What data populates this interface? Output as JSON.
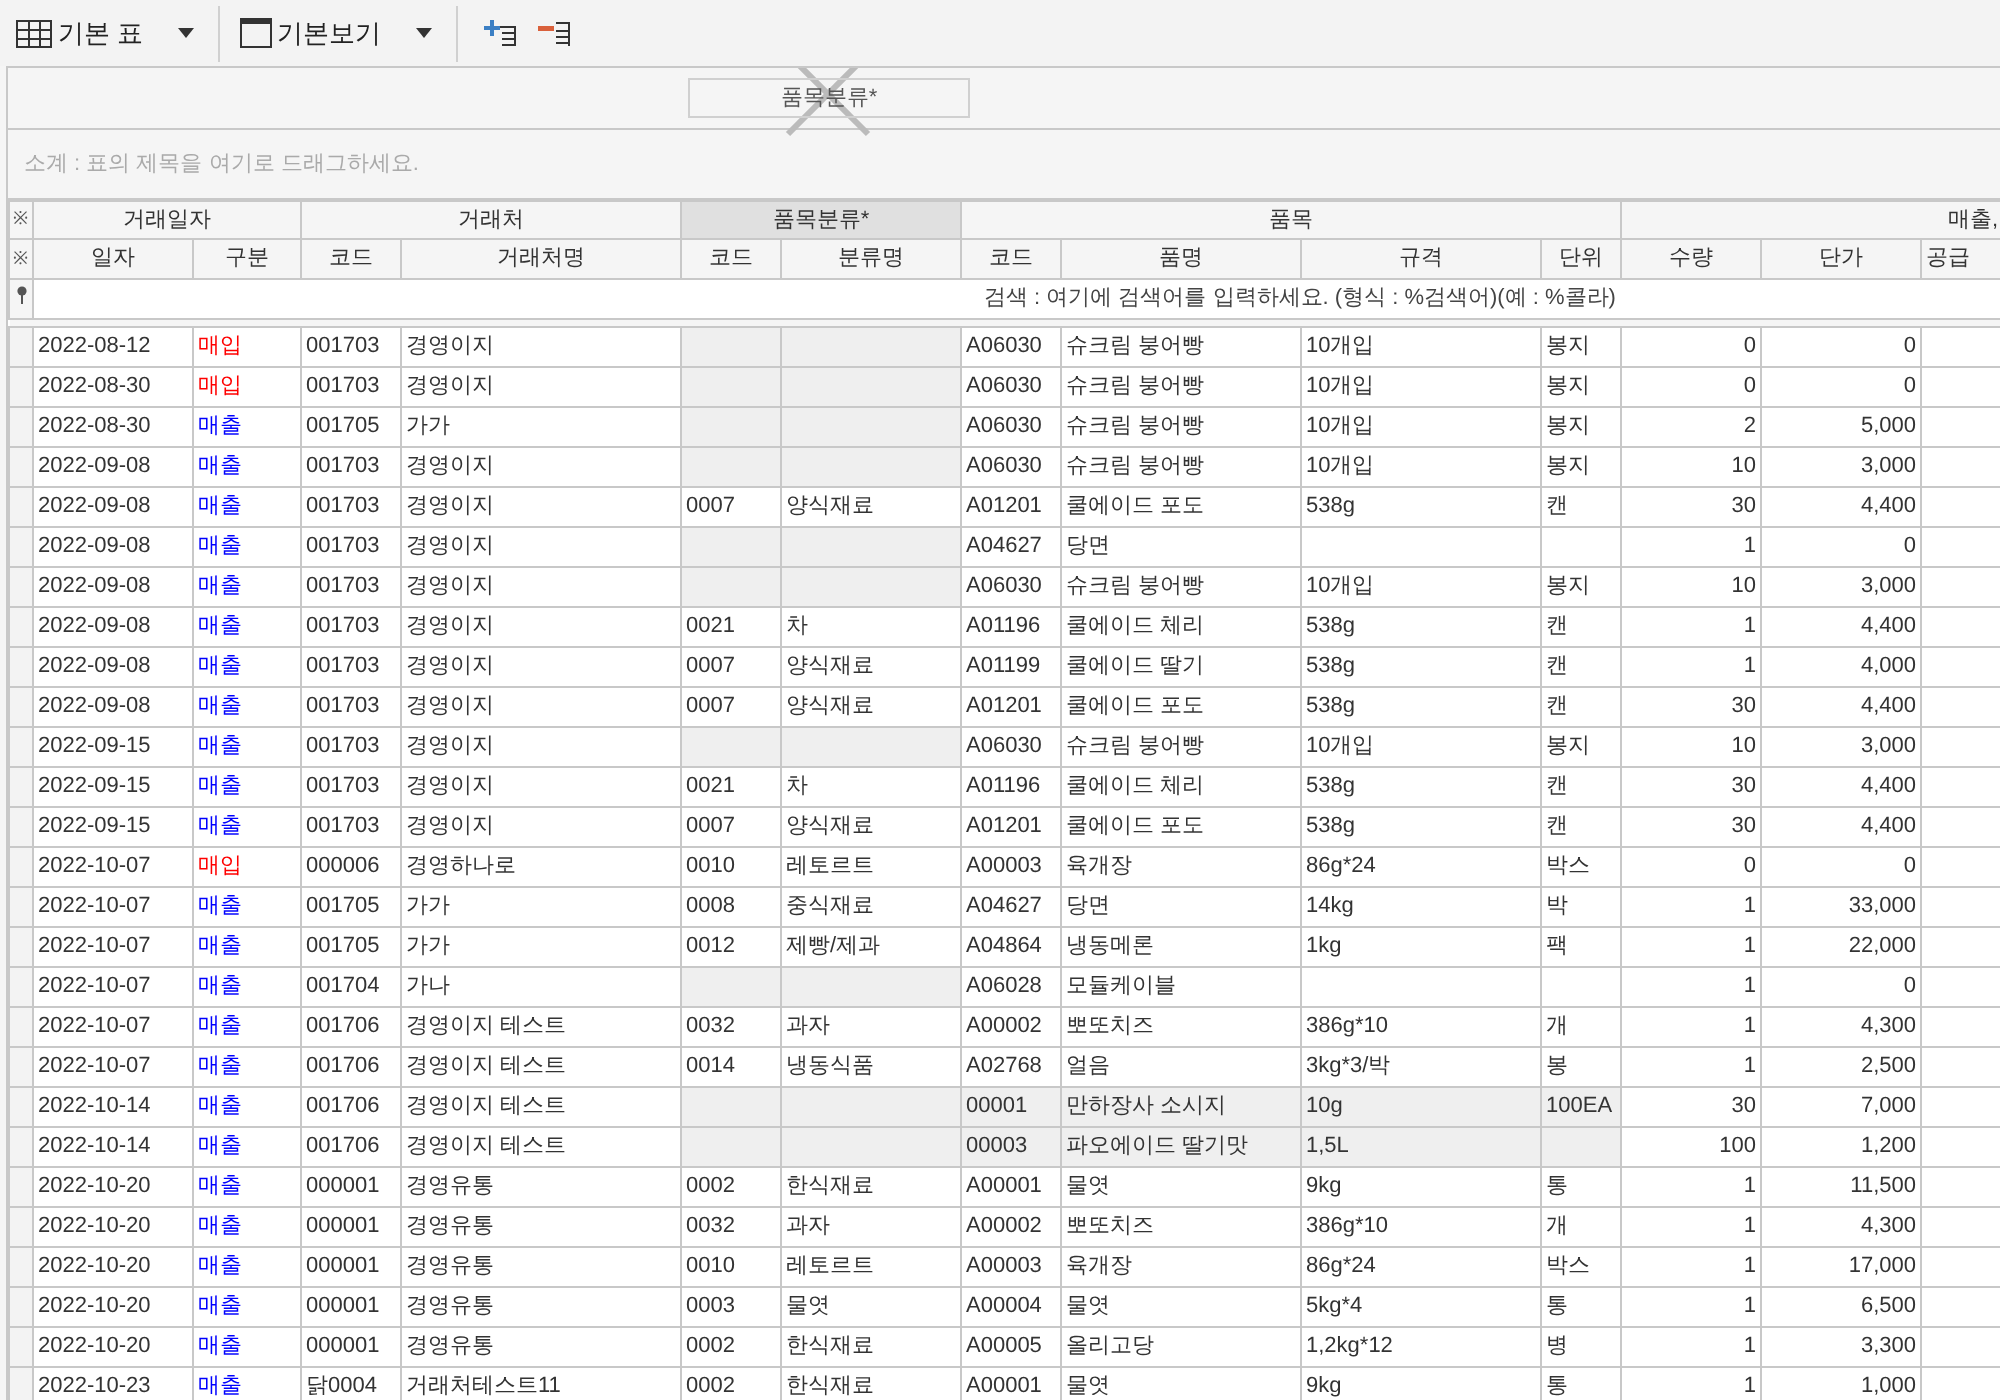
{
  "toolbar": {
    "items": [
      {
        "kind": "table-view",
        "label": "기본 표"
      },
      {
        "kind": "window-view",
        "label": "기본보기"
      },
      {
        "kind": "add-row"
      },
      {
        "kind": "remove-row"
      }
    ]
  },
  "group_panel": {
    "chips": [
      "품목분류*"
    ],
    "drop_blocked": true
  },
  "subtotal_hint": "소계 : 표의 제목을 여기로 드래그하세요.",
  "table": {
    "header_marks": [
      "※",
      "※"
    ],
    "column_groups": [
      {
        "label": "거래일자",
        "selected": false,
        "columns": [
          "일자",
          "구분"
        ]
      },
      {
        "label": "거래처",
        "selected": false,
        "columns": [
          "코드",
          "거래처명"
        ]
      },
      {
        "label": "품목분류*",
        "selected": true,
        "columns": [
          "코드",
          "분류명"
        ]
      },
      {
        "label": "품목",
        "selected": false,
        "columns": [
          "코드",
          "품명",
          "규격",
          "단위"
        ]
      },
      {
        "label": "매출,",
        "selected": false,
        "columns": [
          "수량",
          "단가",
          "공급"
        ]
      }
    ],
    "search_hint": "검색 : 여기에 검색어를 입력하세요. (형식 : %검색어)(예 : %콜라)",
    "rows": [
      {
        "date": "2022-08-12",
        "type": "매입",
        "color": "#ff0000",
        "vendor_code": "001703",
        "vendor_name": "경영이지",
        "item_code": "A06030",
        "item_name": "슈크림 붕어빵",
        "spec": "10개입",
        "unit": "봉지",
        "qty": "0",
        "price": "0",
        "product_shaded": false
      },
      {
        "date": "2022-08-30",
        "type": "매입",
        "color": "#ff0000",
        "vendor_code": "001703",
        "vendor_name": "경영이지",
        "item_code": "A06030",
        "item_name": "슈크림 붕어빵",
        "spec": "10개입",
        "unit": "봉지",
        "qty": "0",
        "price": "0",
        "product_shaded": false
      },
      {
        "date": "2022-08-30",
        "type": "매출",
        "color": "#0000ff",
        "vendor_code": "001705",
        "vendor_name": "가가",
        "item_code": "A06030",
        "item_name": "슈크림 붕어빵",
        "spec": "10개입",
        "unit": "봉지",
        "qty": "2",
        "price": "5,000",
        "product_shaded": false
      },
      {
        "date": "2022-09-08",
        "type": "매출",
        "color": "#0000ff",
        "vendor_code": "001703",
        "vendor_name": "경영이지",
        "item_code": "A06030",
        "item_name": "슈크림 붕어빵",
        "spec": "10개입",
        "unit": "봉지",
        "qty": "10",
        "price": "3,000",
        "product_shaded": false
      },
      {
        "date": "2022-09-08",
        "type": "매출",
        "color": "#0000ff",
        "vendor_code": "001703",
        "vendor_name": "경영이지",
        "class_code": "0007",
        "class_name": "양식재료",
        "item_code": "A01201",
        "item_name": "쿨에이드 포도",
        "spec": "538g",
        "unit": "캔",
        "qty": "30",
        "price": "4,400",
        "product_shaded": false
      },
      {
        "date": "2022-09-08",
        "type": "매출",
        "color": "#0000ff",
        "vendor_code": "001703",
        "vendor_name": "경영이지",
        "item_code": "A04627",
        "item_name": "당면",
        "qty": "1",
        "price": "0",
        "product_shaded": false
      },
      {
        "date": "2022-09-08",
        "type": "매출",
        "color": "#0000ff",
        "vendor_code": "001703",
        "vendor_name": "경영이지",
        "item_code": "A06030",
        "item_name": "슈크림 붕어빵",
        "spec": "10개입",
        "unit": "봉지",
        "qty": "10",
        "price": "3,000",
        "product_shaded": false
      },
      {
        "date": "2022-09-08",
        "type": "매출",
        "color": "#0000ff",
        "vendor_code": "001703",
        "vendor_name": "경영이지",
        "class_code": "0021",
        "class_name": "차",
        "item_code": "A01196",
        "item_name": "쿨에이드 체리",
        "spec": "538g",
        "unit": "캔",
        "qty": "1",
        "price": "4,400",
        "product_shaded": false
      },
      {
        "date": "2022-09-08",
        "type": "매출",
        "color": "#0000ff",
        "vendor_code": "001703",
        "vendor_name": "경영이지",
        "class_code": "0007",
        "class_name": "양식재료",
        "item_code": "A01199",
        "item_name": "쿨에이드 딸기",
        "spec": "538g",
        "unit": "캔",
        "qty": "1",
        "price": "4,000",
        "product_shaded": false
      },
      {
        "date": "2022-09-08",
        "type": "매출",
        "color": "#0000ff",
        "vendor_code": "001703",
        "vendor_name": "경영이지",
        "class_code": "0007",
        "class_name": "양식재료",
        "item_code": "A01201",
        "item_name": "쿨에이드 포도",
        "spec": "538g",
        "unit": "캔",
        "qty": "30",
        "price": "4,400",
        "product_shaded": false
      },
      {
        "date": "2022-09-15",
        "type": "매출",
        "color": "#0000ff",
        "vendor_code": "001703",
        "vendor_name": "경영이지",
        "item_code": "A06030",
        "item_name": "슈크림 붕어빵",
        "spec": "10개입",
        "unit": "봉지",
        "qty": "10",
        "price": "3,000",
        "product_shaded": false
      },
      {
        "date": "2022-09-15",
        "type": "매출",
        "color": "#0000ff",
        "vendor_code": "001703",
        "vendor_name": "경영이지",
        "class_code": "0021",
        "class_name": "차",
        "item_code": "A01196",
        "item_name": "쿨에이드 체리",
        "spec": "538g",
        "unit": "캔",
        "qty": "30",
        "price": "4,400",
        "product_shaded": false
      },
      {
        "date": "2022-09-15",
        "type": "매출",
        "color": "#0000ff",
        "vendor_code": "001703",
        "vendor_name": "경영이지",
        "class_code": "0007",
        "class_name": "양식재료",
        "item_code": "A01201",
        "item_name": "쿨에이드 포도",
        "spec": "538g",
        "unit": "캔",
        "qty": "30",
        "price": "4,400",
        "product_shaded": false
      },
      {
        "date": "2022-10-07",
        "type": "매입",
        "color": "#ff0000",
        "vendor_code": "000006",
        "vendor_name": "경영하나로",
        "class_code": "0010",
        "class_name": "레토르트",
        "item_code": "A00003",
        "item_name": "육개장",
        "spec": "86g*24",
        "unit": "박스",
        "qty": "0",
        "price": "0",
        "product_shaded": false
      },
      {
        "date": "2022-10-07",
        "type": "매출",
        "color": "#0000ff",
        "vendor_code": "001705",
        "vendor_name": "가가",
        "class_code": "0008",
        "class_name": "중식재료",
        "item_code": "A04627",
        "item_name": "당면",
        "spec": "14kg",
        "unit": "박",
        "qty": "1",
        "price": "33,000",
        "product_shaded": false
      },
      {
        "date": "2022-10-07",
        "type": "매출",
        "color": "#0000ff",
        "vendor_code": "001705",
        "vendor_name": "가가",
        "class_code": "0012",
        "class_name": "제빵/제과",
        "item_code": "A04864",
        "item_name": "냉동메론",
        "spec": "1kg",
        "unit": "팩",
        "qty": "1",
        "price": "22,000",
        "product_shaded": false
      },
      {
        "date": "2022-10-07",
        "type": "매출",
        "color": "#0000ff",
        "vendor_code": "001704",
        "vendor_name": "가나",
        "item_code": "A06028",
        "item_name": "모듈케이블",
        "qty": "1",
        "price": "0",
        "product_shaded": false
      },
      {
        "date": "2022-10-07",
        "type": "매출",
        "color": "#0000ff",
        "vendor_code": "001706",
        "vendor_name": "경영이지 테스트",
        "class_code": "0032",
        "class_name": "과자",
        "item_code": "A00002",
        "item_name": "뽀또치즈",
        "spec": "386g*10",
        "unit": "개",
        "qty": "1",
        "price": "4,300",
        "product_shaded": false
      },
      {
        "date": "2022-10-07",
        "type": "매출",
        "color": "#0000ff",
        "vendor_code": "001706",
        "vendor_name": "경영이지 테스트",
        "class_code": "0014",
        "class_name": "냉동식품",
        "item_code": "A02768",
        "item_name": "얼음",
        "spec": "3kg*3/박",
        "unit": "봉",
        "qty": "1",
        "price": "2,500",
        "product_shaded": false
      },
      {
        "date": "2022-10-14",
        "type": "매출",
        "color": "#0000ff",
        "vendor_code": "001706",
        "vendor_name": "경영이지 테스트",
        "item_code": "00001",
        "item_name": "만하장사 소시지",
        "spec": "10g",
        "unit": "100EA",
        "qty": "30",
        "price": "7,000",
        "product_shaded": true
      },
      {
        "date": "2022-10-14",
        "type": "매출",
        "color": "#0000ff",
        "vendor_code": "001706",
        "vendor_name": "경영이지 테스트",
        "item_code": "00003",
        "item_name": "파오에이드 딸기맛",
        "spec": "1,5L",
        "qty": "100",
        "price": "1,200",
        "product_shaded": true
      },
      {
        "date": "2022-10-20",
        "type": "매출",
        "color": "#0000ff",
        "vendor_code": "000001",
        "vendor_name": "경영유통",
        "class_code": "0002",
        "class_name": "한식재료",
        "item_code": "A00001",
        "item_name": "물엿",
        "spec": "9kg",
        "unit": "통",
        "qty": "1",
        "price": "11,500",
        "product_shaded": false
      },
      {
        "date": "2022-10-20",
        "type": "매출",
        "color": "#0000ff",
        "vendor_code": "000001",
        "vendor_name": "경영유통",
        "class_code": "0032",
        "class_name": "과자",
        "item_code": "A00002",
        "item_name": "뽀또치즈",
        "spec": "386g*10",
        "unit": "개",
        "qty": "1",
        "price": "4,300",
        "product_shaded": false
      },
      {
        "date": "2022-10-20",
        "type": "매출",
        "color": "#0000ff",
        "vendor_code": "000001",
        "vendor_name": "경영유통",
        "class_code": "0010",
        "class_name": "레토르트",
        "item_code": "A00003",
        "item_name": "육개장",
        "spec": "86g*24",
        "unit": "박스",
        "qty": "1",
        "price": "17,000",
        "product_shaded": false
      },
      {
        "date": "2022-10-20",
        "type": "매출",
        "color": "#0000ff",
        "vendor_code": "000001",
        "vendor_name": "경영유통",
        "class_code": "0003",
        "class_name": "물엿",
        "item_code": "A00004",
        "item_name": "물엿",
        "spec": "5kg*4",
        "unit": "통",
        "qty": "1",
        "price": "6,500",
        "product_shaded": false
      },
      {
        "date": "2022-10-20",
        "type": "매출",
        "color": "#0000ff",
        "vendor_code": "000001",
        "vendor_name": "경영유통",
        "class_code": "0002",
        "class_name": "한식재료",
        "item_code": "A00005",
        "item_name": "올리고당",
        "spec": "1,2kg*12",
        "unit": "병",
        "qty": "1",
        "price": "3,300",
        "product_shaded": false
      },
      {
        "date": "2022-10-23",
        "type": "매출",
        "color": "#0000ff",
        "vendor_code": "닭0004",
        "vendor_name": "거래처테스트11",
        "class_code": "0002",
        "class_name": "한식재료",
        "item_code": "A00001",
        "item_name": "물엿",
        "spec": "9kg",
        "unit": "통",
        "qty": "1",
        "price": "1,000",
        "product_shaded": false
      }
    ]
  }
}
